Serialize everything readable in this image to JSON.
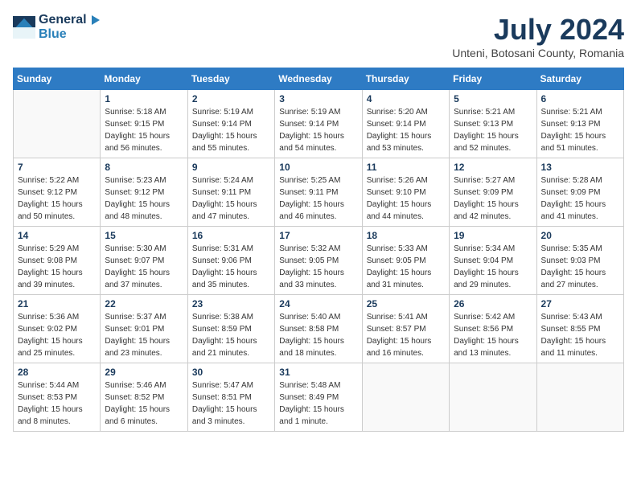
{
  "header": {
    "logo_general": "General",
    "logo_blue": "Blue",
    "month": "July 2024",
    "location": "Unteni, Botosani County, Romania"
  },
  "weekdays": [
    "Sunday",
    "Monday",
    "Tuesday",
    "Wednesday",
    "Thursday",
    "Friday",
    "Saturday"
  ],
  "weeks": [
    [
      {
        "day": "",
        "sunrise": "",
        "sunset": "",
        "daylight": ""
      },
      {
        "day": "1",
        "sunrise": "Sunrise: 5:18 AM",
        "sunset": "Sunset: 9:15 PM",
        "daylight": "Daylight: 15 hours and 56 minutes."
      },
      {
        "day": "2",
        "sunrise": "Sunrise: 5:19 AM",
        "sunset": "Sunset: 9:14 PM",
        "daylight": "Daylight: 15 hours and 55 minutes."
      },
      {
        "day": "3",
        "sunrise": "Sunrise: 5:19 AM",
        "sunset": "Sunset: 9:14 PM",
        "daylight": "Daylight: 15 hours and 54 minutes."
      },
      {
        "day": "4",
        "sunrise": "Sunrise: 5:20 AM",
        "sunset": "Sunset: 9:14 PM",
        "daylight": "Daylight: 15 hours and 53 minutes."
      },
      {
        "day": "5",
        "sunrise": "Sunrise: 5:21 AM",
        "sunset": "Sunset: 9:13 PM",
        "daylight": "Daylight: 15 hours and 52 minutes."
      },
      {
        "day": "6",
        "sunrise": "Sunrise: 5:21 AM",
        "sunset": "Sunset: 9:13 PM",
        "daylight": "Daylight: 15 hours and 51 minutes."
      }
    ],
    [
      {
        "day": "7",
        "sunrise": "Sunrise: 5:22 AM",
        "sunset": "Sunset: 9:12 PM",
        "daylight": "Daylight: 15 hours and 50 minutes."
      },
      {
        "day": "8",
        "sunrise": "Sunrise: 5:23 AM",
        "sunset": "Sunset: 9:12 PM",
        "daylight": "Daylight: 15 hours and 48 minutes."
      },
      {
        "day": "9",
        "sunrise": "Sunrise: 5:24 AM",
        "sunset": "Sunset: 9:11 PM",
        "daylight": "Daylight: 15 hours and 47 minutes."
      },
      {
        "day": "10",
        "sunrise": "Sunrise: 5:25 AM",
        "sunset": "Sunset: 9:11 PM",
        "daylight": "Daylight: 15 hours and 46 minutes."
      },
      {
        "day": "11",
        "sunrise": "Sunrise: 5:26 AM",
        "sunset": "Sunset: 9:10 PM",
        "daylight": "Daylight: 15 hours and 44 minutes."
      },
      {
        "day": "12",
        "sunrise": "Sunrise: 5:27 AM",
        "sunset": "Sunset: 9:09 PM",
        "daylight": "Daylight: 15 hours and 42 minutes."
      },
      {
        "day": "13",
        "sunrise": "Sunrise: 5:28 AM",
        "sunset": "Sunset: 9:09 PM",
        "daylight": "Daylight: 15 hours and 41 minutes."
      }
    ],
    [
      {
        "day": "14",
        "sunrise": "Sunrise: 5:29 AM",
        "sunset": "Sunset: 9:08 PM",
        "daylight": "Daylight: 15 hours and 39 minutes."
      },
      {
        "day": "15",
        "sunrise": "Sunrise: 5:30 AM",
        "sunset": "Sunset: 9:07 PM",
        "daylight": "Daylight: 15 hours and 37 minutes."
      },
      {
        "day": "16",
        "sunrise": "Sunrise: 5:31 AM",
        "sunset": "Sunset: 9:06 PM",
        "daylight": "Daylight: 15 hours and 35 minutes."
      },
      {
        "day": "17",
        "sunrise": "Sunrise: 5:32 AM",
        "sunset": "Sunset: 9:05 PM",
        "daylight": "Daylight: 15 hours and 33 minutes."
      },
      {
        "day": "18",
        "sunrise": "Sunrise: 5:33 AM",
        "sunset": "Sunset: 9:05 PM",
        "daylight": "Daylight: 15 hours and 31 minutes."
      },
      {
        "day": "19",
        "sunrise": "Sunrise: 5:34 AM",
        "sunset": "Sunset: 9:04 PM",
        "daylight": "Daylight: 15 hours and 29 minutes."
      },
      {
        "day": "20",
        "sunrise": "Sunrise: 5:35 AM",
        "sunset": "Sunset: 9:03 PM",
        "daylight": "Daylight: 15 hours and 27 minutes."
      }
    ],
    [
      {
        "day": "21",
        "sunrise": "Sunrise: 5:36 AM",
        "sunset": "Sunset: 9:02 PM",
        "daylight": "Daylight: 15 hours and 25 minutes."
      },
      {
        "day": "22",
        "sunrise": "Sunrise: 5:37 AM",
        "sunset": "Sunset: 9:01 PM",
        "daylight": "Daylight: 15 hours and 23 minutes."
      },
      {
        "day": "23",
        "sunrise": "Sunrise: 5:38 AM",
        "sunset": "Sunset: 8:59 PM",
        "daylight": "Daylight: 15 hours and 21 minutes."
      },
      {
        "day": "24",
        "sunrise": "Sunrise: 5:40 AM",
        "sunset": "Sunset: 8:58 PM",
        "daylight": "Daylight: 15 hours and 18 minutes."
      },
      {
        "day": "25",
        "sunrise": "Sunrise: 5:41 AM",
        "sunset": "Sunset: 8:57 PM",
        "daylight": "Daylight: 15 hours and 16 minutes."
      },
      {
        "day": "26",
        "sunrise": "Sunrise: 5:42 AM",
        "sunset": "Sunset: 8:56 PM",
        "daylight": "Daylight: 15 hours and 13 minutes."
      },
      {
        "day": "27",
        "sunrise": "Sunrise: 5:43 AM",
        "sunset": "Sunset: 8:55 PM",
        "daylight": "Daylight: 15 hours and 11 minutes."
      }
    ],
    [
      {
        "day": "28",
        "sunrise": "Sunrise: 5:44 AM",
        "sunset": "Sunset: 8:53 PM",
        "daylight": "Daylight: 15 hours and 8 minutes."
      },
      {
        "day": "29",
        "sunrise": "Sunrise: 5:46 AM",
        "sunset": "Sunset: 8:52 PM",
        "daylight": "Daylight: 15 hours and 6 minutes."
      },
      {
        "day": "30",
        "sunrise": "Sunrise: 5:47 AM",
        "sunset": "Sunset: 8:51 PM",
        "daylight": "Daylight: 15 hours and 3 minutes."
      },
      {
        "day": "31",
        "sunrise": "Sunrise: 5:48 AM",
        "sunset": "Sunset: 8:49 PM",
        "daylight": "Daylight: 15 hours and 1 minute."
      },
      {
        "day": "",
        "sunrise": "",
        "sunset": "",
        "daylight": ""
      },
      {
        "day": "",
        "sunrise": "",
        "sunset": "",
        "daylight": ""
      },
      {
        "day": "",
        "sunrise": "",
        "sunset": "",
        "daylight": ""
      }
    ]
  ]
}
